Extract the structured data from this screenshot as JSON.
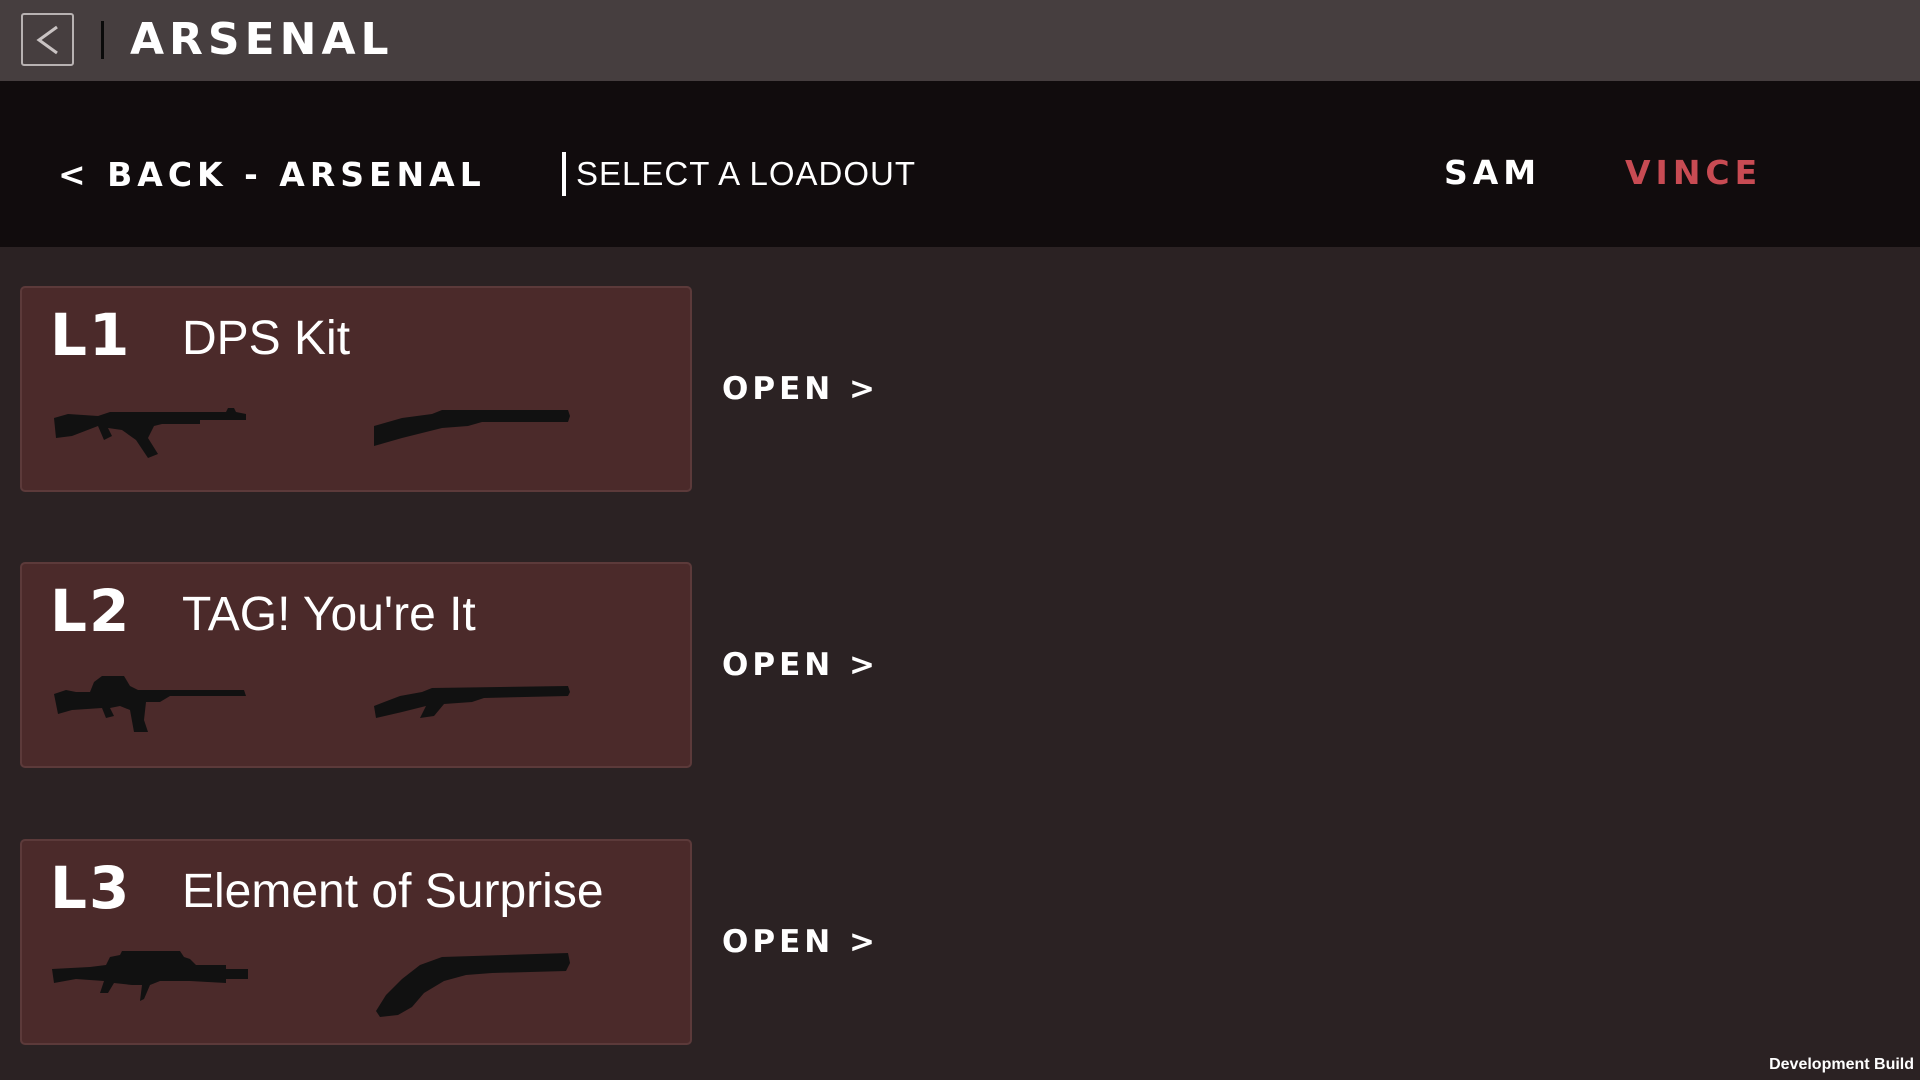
{
  "topbar": {
    "back_icon": "chevron-left-icon",
    "title": "ARSENAL"
  },
  "nav": {
    "back_label": "< BACK - ARSENAL",
    "subtitle": "SELECT A LOADOUT",
    "tabs": [
      {
        "label": "SAM",
        "active": false
      },
      {
        "label": "VINCE",
        "active": true
      }
    ]
  },
  "loadouts": [
    {
      "id": "L1",
      "name": "DPS Kit",
      "primary_icon": "assault-rifle-icon",
      "secondary_icon": "shotgun-icon",
      "open_label": "OPEN >"
    },
    {
      "id": "L2",
      "name": "TAG! You're It",
      "primary_icon": "carbine-rifle-icon",
      "secondary_icon": "shotgun-icon",
      "open_label": "OPEN >"
    },
    {
      "id": "L3",
      "name": "Element of Surprise",
      "primary_icon": "sniper-rifle-icon",
      "secondary_icon": "sawed-off-shotgun-icon",
      "open_label": "OPEN >"
    }
  ],
  "footer": {
    "build_label": "Development Build"
  },
  "colors": {
    "background": "#2b2223",
    "topbar": "#463e3f",
    "navbar": "#110c0d",
    "card": "#4b2a2a",
    "active_tab": "#c84b53"
  }
}
